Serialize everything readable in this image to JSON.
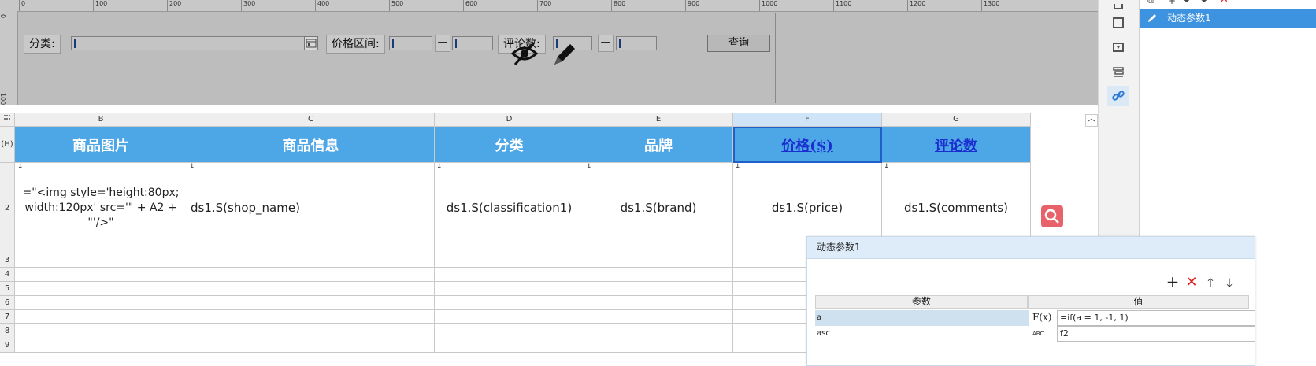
{
  "param_panel": {
    "ruler_marks": [
      "0",
      "100",
      "200",
      "300",
      "400",
      "500",
      "600",
      "700",
      "800",
      "900",
      "1000",
      "1100",
      "1200",
      "1300"
    ],
    "ruler_left_marks": [
      "0",
      "100"
    ],
    "label_category": "分类:",
    "label_price_range": "价格区间:",
    "label_reviews": "评论数:",
    "dash": "—",
    "query_button": "查询"
  },
  "sheet": {
    "columns": [
      "B",
      "C",
      "D",
      "E",
      "F",
      "G"
    ],
    "selected_column": "F",
    "header_row_label": "(H)",
    "header_row": [
      "商品图片",
      "商品信息",
      "分类",
      "品牌",
      "价格($)",
      "评论数"
    ],
    "row2_label": "2",
    "row2": [
      "=\"<img style='height:80px; width:120px' src='\" + A2 + \"'/>\"",
      "ds1.S(shop_name)",
      "ds1.S(classification1)",
      "ds1.S(brand)",
      "ds1.S(price)",
      "ds1.S(comments)"
    ],
    "empty_row_labels": [
      "3",
      "4",
      "5",
      "6",
      "7",
      "8",
      "9"
    ]
  },
  "param_list": {
    "items": [
      "动态参数1"
    ]
  },
  "dialog": {
    "title": "动态参数1",
    "col_param": "参数",
    "col_value": "值",
    "rows": [
      {
        "name": "a",
        "value": "=if(a = 1, -1, 1)",
        "type_icon": "F(x)"
      },
      {
        "name": "asc",
        "value": "f2",
        "type_icon": "ABC"
      }
    ]
  },
  "colors": {
    "header_blue": "#4da6e6",
    "selection_blue": "#3d93e0",
    "link_blue": "#1b2fd1",
    "delete_red": "#e02020",
    "search_badge": "#e8626a"
  }
}
